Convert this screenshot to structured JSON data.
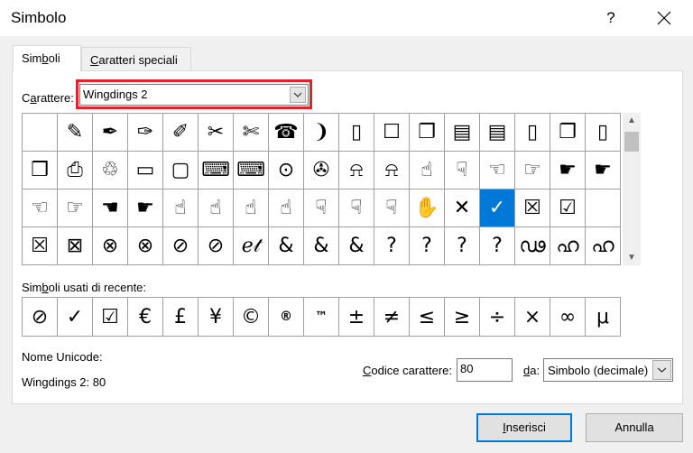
{
  "window": {
    "title": "Simbolo",
    "help": "?"
  },
  "tabs": [
    {
      "pre": "Sim",
      "key": "b",
      "post": "oli"
    },
    {
      "pre": "",
      "key": "C",
      "post": "aratteri speciali"
    }
  ],
  "font": {
    "label_pre": "C",
    "label_key": "a",
    "label_post": "rattere:",
    "value": "Wingdings 2"
  },
  "symbol_grid": [
    [
      "",
      "✎",
      "✒",
      "✑",
      "✐",
      "✂",
      "✄",
      "☎",
      "❩",
      "▯",
      "☐",
      "❐",
      "▤",
      "▤",
      "▯",
      "❐",
      "▯"
    ],
    [
      "❒",
      "⎙",
      "♲",
      "▭",
      "▢",
      "⌨",
      "⌨",
      "⊙",
      "✇",
      "⍾",
      "⍾",
      "☝",
      "☟",
      "☜",
      "☞",
      "☛",
      "☛"
    ],
    [
      "☜",
      "☞",
      "☚",
      "☛",
      "☝",
      "☝",
      "☝",
      "☝",
      "☟",
      "☟",
      "☟",
      "✋",
      "✕",
      "✓",
      "☒",
      "☑",
      ""
    ],
    [
      "☒",
      "⊠",
      "⊗",
      "⊗",
      "⊘",
      "⊘",
      "ℯ𝓉",
      "&",
      "&",
      "&",
      "?",
      "?",
      "?",
      "?",
      "ഢ",
      "ഹ",
      "ഹ"
    ]
  ],
  "selected_cell": {
    "row": 2,
    "col": 13
  },
  "recent": {
    "label_pre": "Sim",
    "label_key": "b",
    "label_post": "oli usati di recente:",
    "items": [
      "⊘",
      "✓",
      "☑",
      "€",
      "£",
      "¥",
      "©",
      "®",
      "™",
      "±",
      "≠",
      "≤",
      "≥",
      "÷",
      "×",
      "∞",
      "μ"
    ]
  },
  "unicode": {
    "label": "Nome Unicode:",
    "value": "Wingdings 2: 80"
  },
  "code": {
    "label_pre": "",
    "label_key": "C",
    "label_post": "odice carattere:",
    "value": "80"
  },
  "from": {
    "label_pre": "",
    "label_key": "d",
    "label_post": "a:",
    "value": "Simbolo (decimale)"
  },
  "buttons": {
    "insert_pre": "",
    "insert_key": "I",
    "insert_post": "nserisci",
    "cancel": "Annulla"
  },
  "colors": {
    "selection": "#0078d7",
    "highlight": "#e8202a",
    "default_button_border": "#0078d7"
  }
}
